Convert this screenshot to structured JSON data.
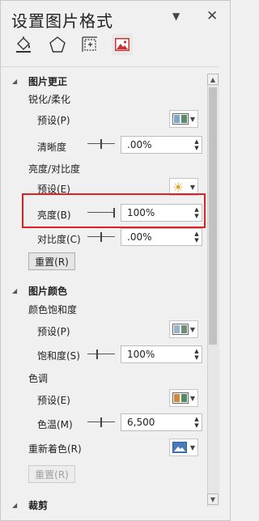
{
  "pane": {
    "title": "设置图片格式",
    "dropdown_icon": "chevron-down-icon",
    "close_icon": "close-icon",
    "tabs": [
      {
        "name": "fill-line-tab",
        "icon": "paint-bucket-icon"
      },
      {
        "name": "effects-tab",
        "icon": "pentagon-icon"
      },
      {
        "name": "size-properties-tab",
        "icon": "size-position-icon"
      },
      {
        "name": "picture-tab",
        "icon": "picture-icon",
        "active": true
      }
    ]
  },
  "sections": {
    "correction": {
      "title": "图片更正",
      "sharpen": {
        "header": "锐化/柔化",
        "preset_label": "预设(P)",
        "sharpness_label": "清晰度",
        "sharpness_value": ".00%"
      },
      "brightness_contrast": {
        "header": "亮度/对比度",
        "preset_label": "预设(E)",
        "brightness_label": "亮度(B)",
        "brightness_value": "100%",
        "contrast_label": "对比度(C)",
        "contrast_value": ".00%"
      },
      "reset_label": "重置(R)"
    },
    "color": {
      "title": "图片颜色",
      "saturation": {
        "header": "颜色饱和度",
        "preset_label": "预设(P)",
        "saturation_label": "饱和度(S)",
        "saturation_value": "100%"
      },
      "tone": {
        "header": "色调",
        "preset_label": "预设(E)",
        "temperature_label": "色温(M)",
        "temperature_value": "6,500"
      },
      "recolor_label": "重新着色(R)",
      "reset_label": "重置(R)"
    },
    "crop": {
      "title": "裁剪"
    }
  },
  "colors": {
    "highlight": "#e02020",
    "icon_red": "#c8352e"
  }
}
